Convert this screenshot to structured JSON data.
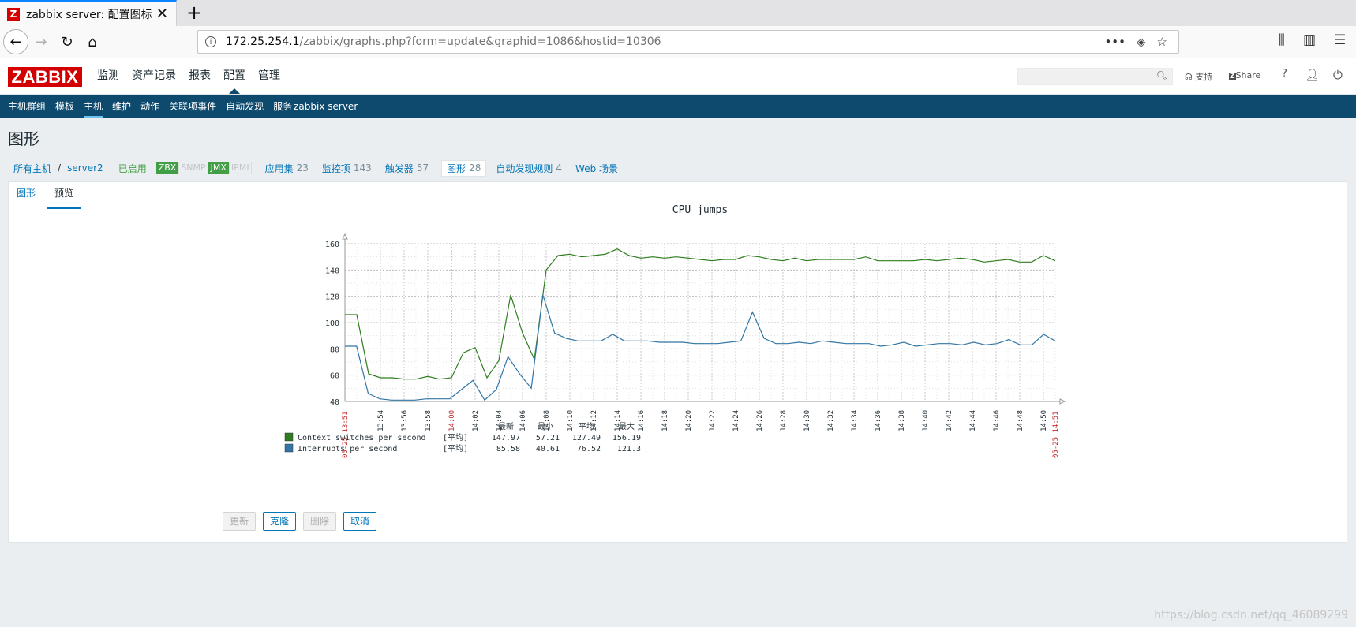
{
  "browser": {
    "tab_title": "zabbix server: 配置图标",
    "favicon": "Z",
    "url_host": "172.25.254.1",
    "url_path": "/zabbix/graphs.php?form=update&graphid=1086&hostid=10306"
  },
  "header": {
    "logo": "ZABBIX",
    "menu": [
      "监测",
      "资产记录",
      "报表",
      "配置",
      "管理"
    ],
    "support": "支持",
    "share": "Share",
    "help": "?"
  },
  "submenu": {
    "items": [
      "主机群组",
      "模板",
      "主机",
      "维护",
      "动作",
      "关联项事件",
      "自动发现",
      "服务"
    ],
    "server_name": "zabbix server"
  },
  "page_title": "图形",
  "hostnav": {
    "all_hosts": "所有主机",
    "sep": "/",
    "host": "server2",
    "status": "已启用",
    "badges": [
      {
        "label": "ZBX",
        "active": true
      },
      {
        "label": "SNMP",
        "active": false
      },
      {
        "label": "JMX",
        "active": true
      },
      {
        "label": "IPMI",
        "active": false
      }
    ],
    "links": [
      {
        "label": "应用集",
        "count": "23"
      },
      {
        "label": "监控项",
        "count": "143"
      },
      {
        "label": "触发器",
        "count": "57"
      },
      {
        "label": "图形",
        "count": "28"
      },
      {
        "label": "自动发现规则",
        "count": "4"
      },
      {
        "label": "Web 场景",
        "count": ""
      }
    ]
  },
  "tabs": [
    "图形",
    "预览"
  ],
  "chart_data": {
    "type": "line",
    "title": "CPU jumps",
    "ylim": [
      40,
      160
    ],
    "yticks": [
      "160",
      "140",
      "120",
      "100",
      "80",
      "60",
      "40"
    ],
    "start_label": "05-25 13:51",
    "end_label": "05-25 14:51",
    "mid_label": "14:00",
    "x_ticks": [
      "13:54",
      "13:56",
      "13:58",
      "14:00",
      "14:02",
      "14:04",
      "14:06",
      "14:08",
      "14:10",
      "14:12",
      "14:14",
      "14:16",
      "14:18",
      "14:20",
      "14:22",
      "14:24",
      "14:26",
      "14:28",
      "14:30",
      "14:32",
      "14:34",
      "14:36",
      "14:38",
      "14:40",
      "14:42",
      "14:44",
      "14:46",
      "14:48",
      "14:50"
    ],
    "series": [
      {
        "name": "Context switches per second",
        "color": "#2e7d1f",
        "last": "147.97",
        "min": "57.21",
        "avg": "127.49",
        "max": "156.19",
        "values": [
          106,
          106,
          61,
          58,
          58,
          57,
          57,
          59,
          57,
          58,
          77,
          81,
          58,
          71,
          121,
          92,
          72,
          140,
          151,
          152,
          150,
          151,
          152,
          156,
          151,
          149,
          150,
          149,
          150,
          149,
          148,
          147,
          148,
          148,
          151,
          150,
          148,
          147,
          149,
          147,
          148,
          148,
          148,
          148,
          150,
          147,
          147,
          147,
          147,
          148,
          147,
          148,
          149,
          148,
          146,
          147,
          148,
          146,
          146,
          151,
          147
        ]
      },
      {
        "name": "Interrupts per second",
        "color": "#3276a5",
        "last": "85.58",
        "min": "40.61",
        "avg": "76.52",
        "max": "121.3",
        "values": [
          82,
          82,
          46,
          42,
          41,
          41,
          41,
          42,
          42,
          42,
          49,
          56,
          41,
          49,
          74,
          61,
          50,
          121,
          92,
          88,
          86,
          86,
          86,
          91,
          86,
          86,
          86,
          85,
          85,
          85,
          84,
          84,
          84,
          85,
          86,
          108,
          88,
          84,
          84,
          85,
          84,
          86,
          85,
          84,
          84,
          84,
          82,
          83,
          85,
          82,
          83,
          84,
          84,
          83,
          85,
          83,
          84,
          87,
          83,
          83,
          91,
          86
        ]
      }
    ],
    "legend_header": [
      "最新",
      "最小",
      "平均",
      "最大"
    ],
    "legend_func": "[平均]"
  },
  "buttons": {
    "update": "更新",
    "clone": "克隆",
    "delete": "删除",
    "cancel": "取消"
  },
  "watermark": "https://blog.csdn.net/qq_46089299"
}
